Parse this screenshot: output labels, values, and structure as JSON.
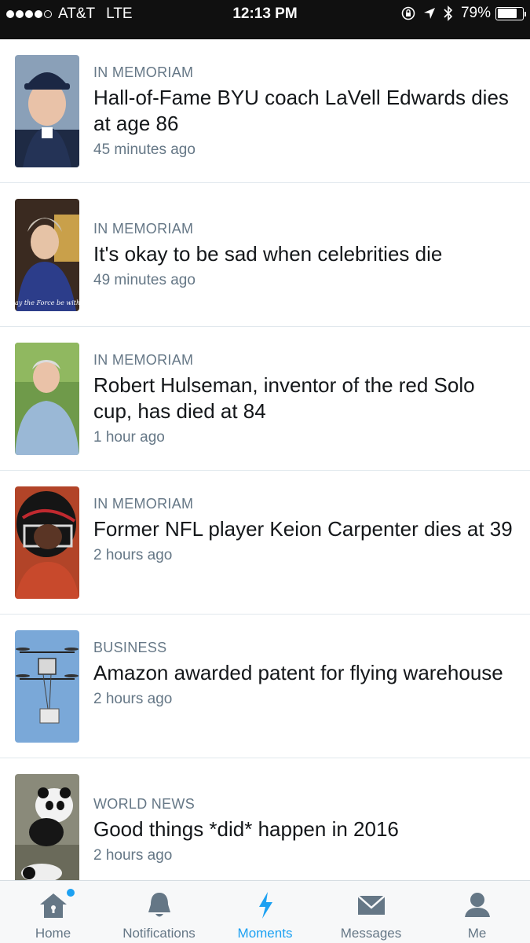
{
  "status": {
    "carrier": "AT&T",
    "network": "LTE",
    "time": "12:13 PM",
    "battery": "79%",
    "battery_level": 0.79
  },
  "feed": [
    {
      "category": "IN MEMORIAM",
      "headline": "Hall-of-Fame BYU coach LaVell Edwards dies at age 86",
      "time": "45 minutes ago"
    },
    {
      "category": "IN MEMORIAM",
      "headline": "It's okay to be sad when celebrities die",
      "time": "49 minutes ago",
      "thumb_caption": "ay the Force be with"
    },
    {
      "category": "IN MEMORIAM",
      "headline": "Robert Hulseman, inventor of the red Solo cup, has died at 84",
      "time": "1 hour ago"
    },
    {
      "category": "IN MEMORIAM",
      "headline": "Former NFL player Keion Carpenter dies at 39",
      "time": "2 hours ago"
    },
    {
      "category": "BUSINESS",
      "headline": "Amazon awarded patent for flying warehouse",
      "time": "2 hours ago"
    },
    {
      "category": "WORLD NEWS",
      "headline": "Good things *did* happen in 2016",
      "time": "2 hours ago"
    }
  ],
  "tabs": [
    {
      "label": "Home",
      "icon": "home-icon",
      "active": false,
      "badge": true
    },
    {
      "label": "Notifications",
      "icon": "bell-icon",
      "active": false
    },
    {
      "label": "Moments",
      "icon": "lightning-icon",
      "active": true
    },
    {
      "label": "Messages",
      "icon": "envelope-icon",
      "active": false
    },
    {
      "label": "Me",
      "icon": "person-icon",
      "active": false
    }
  ],
  "colors": {
    "accent": "#1da1f2",
    "tab_inactive": "#657786",
    "text_secondary": "#657786",
    "status_bar": "#101010"
  }
}
